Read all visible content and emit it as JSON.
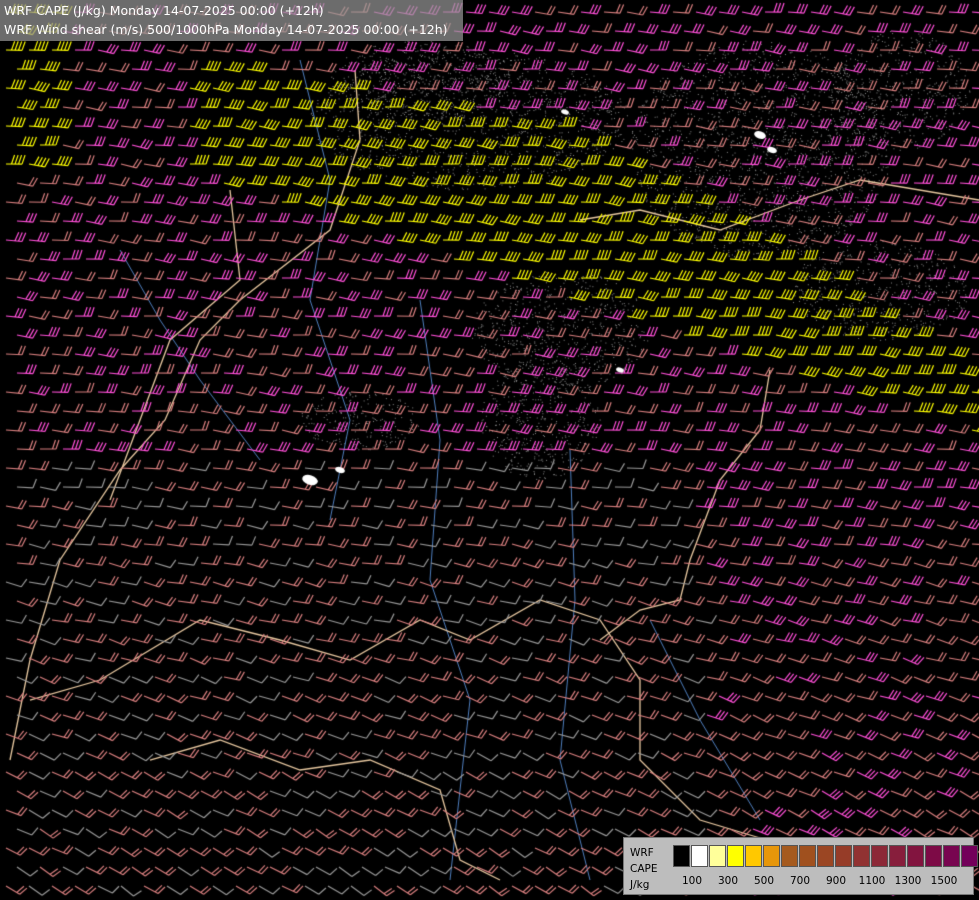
{
  "header": {
    "line1": "WRF CAPE (J/kg) Monday 14-07-2025 00:00 (+12h)",
    "line2": "WRF Wind shear (m/s) 500/1000hPa Monday 14-07-2025 00:00 (+12h)"
  },
  "legend": {
    "label_model": "WRF",
    "label_field": "CAPE",
    "label_unit": "J/kg",
    "colors": [
      "#000000",
      "#ffffff",
      "#ffff9a",
      "#ffff00",
      "#ffc800",
      "#e6960a",
      "#a55a1e",
      "#a0501e",
      "#9b4623",
      "#963c28",
      "#913232",
      "#8c2837",
      "#871e3c",
      "#82143f",
      "#7d0a46",
      "#780550",
      "#73005a",
      "#6e0064",
      "#b4006e"
    ],
    "ticks": [
      "100",
      "300",
      "500",
      "700",
      "900",
      "1100",
      "1300",
      "1500"
    ]
  },
  "map": {
    "shear_colors": {
      "weak": "#9a9a9a",
      "moderate": "#d97f7f",
      "strong": "#ff4fd8",
      "very_strong": "#ffff00"
    },
    "border_color": "#e8c8a0",
    "river_color": "#4f7fbf",
    "cape_fill_color": "#888888"
  }
}
